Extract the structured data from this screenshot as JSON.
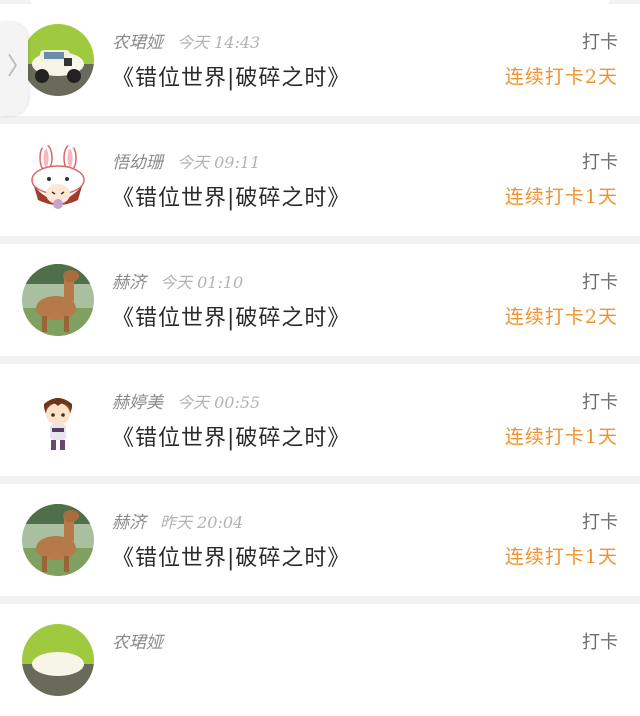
{
  "side_handle": {
    "icon": "chevron-right-icon",
    "glyph": "〉"
  },
  "posts": [
    {
      "user": "农珺娅",
      "time": "今天 14:43",
      "book": "《错位世界|破碎之时》",
      "checkin": "打卡",
      "streak": "连续打卡2天",
      "avatar_icon": "toy-car-avatar-icon"
    },
    {
      "user": "悟幼珊",
      "time": "今天 09:11",
      "book": "《错位世界|破碎之时》",
      "checkin": "打卡",
      "streak": "连续打卡1天",
      "avatar_icon": "bunny-avatar-icon"
    },
    {
      "user": "赫济",
      "time": "今天 01:10",
      "book": "《错位世界|破碎之时》",
      "checkin": "打卡",
      "streak": "连续打卡2天",
      "avatar_icon": "alpaca-avatar-icon"
    },
    {
      "user": "赫婷美",
      "time": "今天 00:55",
      "book": "《错位世界|破碎之时》",
      "checkin": "打卡",
      "streak": "连续打卡1天",
      "avatar_icon": "chibi-boy-avatar-icon"
    },
    {
      "user": "赫济",
      "time": "昨天 20:04",
      "book": "《错位世界|破碎之时》",
      "checkin": "打卡",
      "streak": "连续打卡1天",
      "avatar_icon": "alpaca-avatar-icon"
    },
    {
      "user": "农珺娅",
      "time": "",
      "book": "",
      "checkin": "打卡",
      "streak": "",
      "avatar_icon": "toy-car-avatar-icon"
    }
  ],
  "colors": {
    "streak": "#f0922e",
    "book_title": "#2b2b2b",
    "user": "#8b8b8b",
    "time": "#b3b3b3",
    "background": "#f2f2f2"
  }
}
